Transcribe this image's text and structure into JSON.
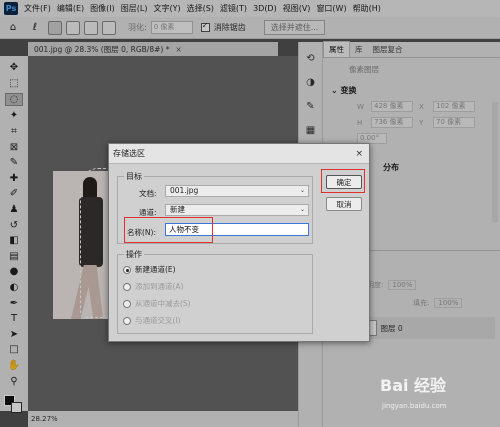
{
  "menubar": {
    "logo": "Ps",
    "items": [
      "文件(F)",
      "编辑(E)",
      "图像(I)",
      "图层(L)",
      "文字(Y)",
      "选择(S)",
      "滤镜(T)",
      "3D(D)",
      "视图(V)",
      "窗口(W)",
      "帮助(H)"
    ]
  },
  "options": {
    "feather_label": "羽化:",
    "feather_value": "0 像素",
    "antialias_label": "消除锯齿",
    "select_subject_label": "选择并遮住..."
  },
  "doc_tab": {
    "title": "001.jpg @ 28.3% (图层 0, RGB/8#) *",
    "close": "×"
  },
  "status": {
    "zoom": "28.27%"
  },
  "panel": {
    "tabs": [
      "属性",
      "库",
      "图层复合"
    ],
    "subtitle": "像素图层",
    "transform_label": "变换",
    "w_label": "W",
    "w_value": "428 像素",
    "h_label": "H",
    "h_value": "736 像素",
    "x_label": "X",
    "x_value": "102 像素",
    "y_label": "Y",
    "y_value": "70 像素",
    "angle": "0.00°",
    "align_label": "分布",
    "opacity_label": "不透明度:",
    "opacity_value": "100%",
    "fill_label": "填充:",
    "fill_value": "100%",
    "layer_name": "图层 0"
  },
  "dialog": {
    "title": "存储选区",
    "close": "×",
    "target_group": "目标",
    "doc_label": "文档:",
    "doc_value": "001.jpg",
    "channel_label": "通道:",
    "channel_value": "新建",
    "name_label": "名称(N):",
    "name_value": "人物不变",
    "operation_group": "操作",
    "ops": [
      "新建通道(E)",
      "添加到通道(A)",
      "从通道中减去(S)",
      "与通道交叉(I)"
    ],
    "ok_label": "确定",
    "cancel_label": "取消"
  },
  "watermark": {
    "brand": "Bai 经验",
    "url": "jingyan.baidu.com"
  },
  "colors": {
    "highlight_box": "#e0322d",
    "input_focus": "#3b78d8"
  }
}
